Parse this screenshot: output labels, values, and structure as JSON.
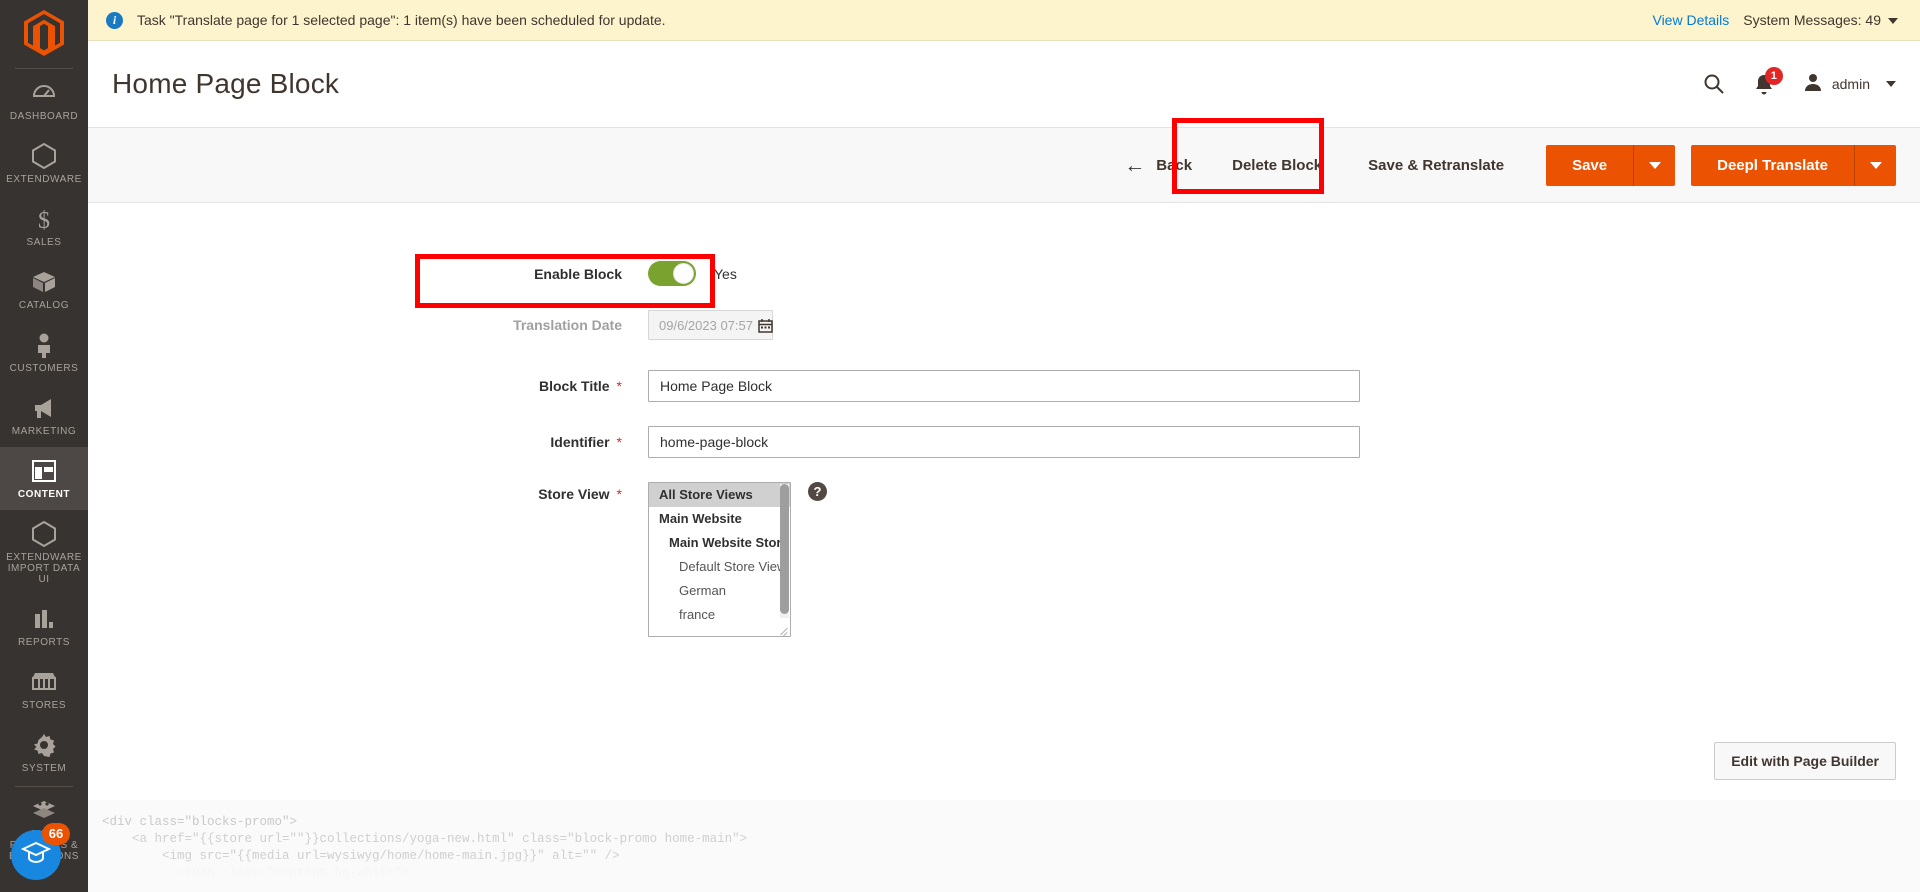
{
  "sidebar": {
    "logo_name": "magento-logo-icon",
    "items": [
      {
        "label": "DASHBOARD",
        "icon": "dashboard-icon",
        "active": false
      },
      {
        "label": "EXTENDWARE",
        "icon": "hexagon-icon",
        "active": false
      },
      {
        "label": "SALES",
        "icon": "dollar-icon",
        "active": false
      },
      {
        "label": "CATALOG",
        "icon": "box-icon",
        "active": false
      },
      {
        "label": "CUSTOMERS",
        "icon": "person-icon",
        "active": false
      },
      {
        "label": "MARKETING",
        "icon": "megaphone-icon",
        "active": false
      },
      {
        "label": "CONTENT",
        "icon": "layout-icon",
        "active": true
      },
      {
        "label": "EXTENDWARE IMPORT DATA UI",
        "icon": "hexagon-icon",
        "active": false
      },
      {
        "label": "REPORTS",
        "icon": "bar-chart-icon",
        "active": false
      },
      {
        "label": "STORES",
        "icon": "storefront-icon",
        "active": false
      },
      {
        "label": "SYSTEM",
        "icon": "gear-icon",
        "active": false
      },
      {
        "label": "FIND PARTNERS & EXTENSIONS",
        "icon": "puzzle-block-icon",
        "active": false
      }
    ],
    "help_widget": {
      "count": "66",
      "icon": "graduation-cap-icon"
    }
  },
  "notice": {
    "icon": "info-icon",
    "message": "Task \"Translate page for 1 selected page\": 1 item(s) have been scheduled for update.",
    "view_details": "View Details",
    "system_messages": "System Messages: 49"
  },
  "header": {
    "title": "Home Page Block",
    "search_icon": "search-icon",
    "notifications_icon": "bell-icon",
    "notifications_count": "1",
    "user_icon": "user-avatar-icon",
    "user_name": "admin"
  },
  "toolbar": {
    "back_label": "Back",
    "back_icon": "arrow-left-icon",
    "delete_label": "Delete Block",
    "save_retranslate_label": "Save & Retranslate",
    "save_label": "Save",
    "deepl_label": "Deepl Translate",
    "dropdown_icon": "caret-down-icon"
  },
  "form": {
    "enable_block": {
      "label": "Enable Block",
      "value": "Yes",
      "toggle_state": "on"
    },
    "translation_date": {
      "label": "Translation Date",
      "value": "09/6/2023 07:57",
      "calendar_icon": "calendar-icon",
      "disabled": "true"
    },
    "block_title": {
      "label": "Block Title",
      "value": "Home Page Block",
      "required": "*"
    },
    "identifier": {
      "label": "Identifier",
      "value": "home-page-block",
      "required": "*"
    },
    "store_view": {
      "label": "Store View",
      "required": "*",
      "help_icon": "question-mark-icon",
      "options": [
        {
          "label": "All Store Views",
          "level": 1,
          "selected": true
        },
        {
          "label": "Main Website",
          "level": 1,
          "selected": false
        },
        {
          "label": "Main Website Store",
          "level": 2,
          "selected": false
        },
        {
          "label": "Default Store View",
          "level": 3,
          "selected": false
        },
        {
          "label": "German",
          "level": 3,
          "selected": false
        },
        {
          "label": "france",
          "level": 3,
          "selected": false
        }
      ]
    }
  },
  "page_builder": {
    "label": "Edit with Page Builder"
  },
  "content_code": {
    "lines": [
      "<div class=\"blocks-promo\">",
      "    <a href=\"{{store url=\"\"}}collections/yoga-new.html\" class=\"block-promo home-main\">",
      "        <img src=\"{{media url=wysiwyg/home/home-main.jpg}}\" alt=\"\" />",
      "          <span class=\"content bg-white\">"
    ]
  },
  "highlights": {
    "save_retranslate": "red-highlight-box",
    "translation_date": "red-highlight-box",
    "color": "#ff0000"
  }
}
